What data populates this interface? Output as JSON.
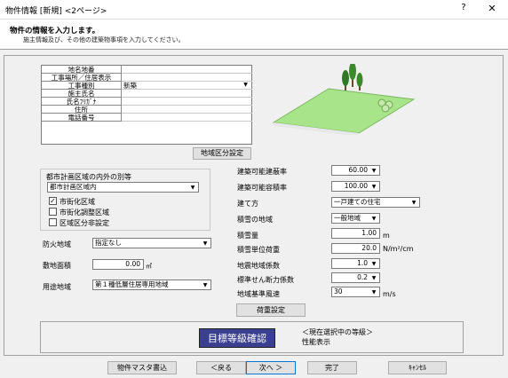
{
  "window": {
    "title": "物件情報 [新規] <2ページ>",
    "help": "?",
    "close": "✕"
  },
  "header": {
    "title": "物件の情報を入力します。",
    "subtitle": "施主情報及び、その他の建築物事項を入力してください。"
  },
  "info_table": {
    "rows": [
      {
        "label": "地名地番",
        "value": ""
      },
      {
        "label": "工事場所／住居表示",
        "value": ""
      },
      {
        "label": "工事種別",
        "value": "新築"
      },
      {
        "label": "施主氏名",
        "value": ""
      },
      {
        "label": "氏名ﾌﾘｶﾞﾅ",
        "value": ""
      },
      {
        "label": "住所",
        "value": ""
      },
      {
        "label": "電話番号",
        "value": ""
      }
    ]
  },
  "area_button": "地域区分設定",
  "city_planning": {
    "label": "都市計画区域の内外の別等",
    "select": "都市計画区域内",
    "checks": [
      {
        "label": "市街化区域",
        "checked": true
      },
      {
        "label": "市街化調整区域",
        "checked": false
      },
      {
        "label": "区域区分非設定",
        "checked": false
      }
    ]
  },
  "fire_zone": {
    "label": "防火地域",
    "value": "指定なし"
  },
  "site_area": {
    "label": "敷地面積",
    "value": "0.00",
    "unit": "㎡"
  },
  "use_zone": {
    "label": "用途地域",
    "value": "第１種低層住居専用地域"
  },
  "right_fields": [
    {
      "label": "建築可能建蔽率",
      "value": "60.00",
      "type": "select",
      "unit": ""
    },
    {
      "label": "建築可能容積率",
      "value": "100.00",
      "type": "select",
      "unit": ""
    },
    {
      "label": "建て方",
      "value": "一戸建ての住宅",
      "type": "select",
      "unit": ""
    },
    {
      "label": "積雪の地域",
      "value": "一般地域",
      "type": "select",
      "unit": ""
    },
    {
      "label": "積雪量",
      "value": "1.00",
      "type": "input",
      "unit": "m"
    },
    {
      "label": "積雪単位荷重",
      "value": "20.0",
      "type": "input",
      "unit": "N/m²/cm"
    },
    {
      "label": "地震地域係数",
      "value": "1.0",
      "type": "select",
      "unit": ""
    },
    {
      "label": "標準せん断力係数",
      "value": "0.2",
      "type": "select",
      "unit": ""
    },
    {
      "label": "地域基準風速",
      "value": "30",
      "type": "select",
      "unit": "m/s"
    }
  ],
  "load_button": "荷重設定",
  "grade": {
    "button": "目標等級確認",
    "current_label": "＜現在選択中の等級＞",
    "current_value": "性能表示"
  },
  "footer": {
    "master": "物件マスタ書込",
    "back": "＜戻る",
    "next": "次へ ＞",
    "finish": "完了",
    "cancel": "ｷｬﾝｾﾙ"
  },
  "colors": {
    "grade_button": "#3b3f8f",
    "grass": "#a8e58a",
    "tree": "#3a8a2a"
  }
}
